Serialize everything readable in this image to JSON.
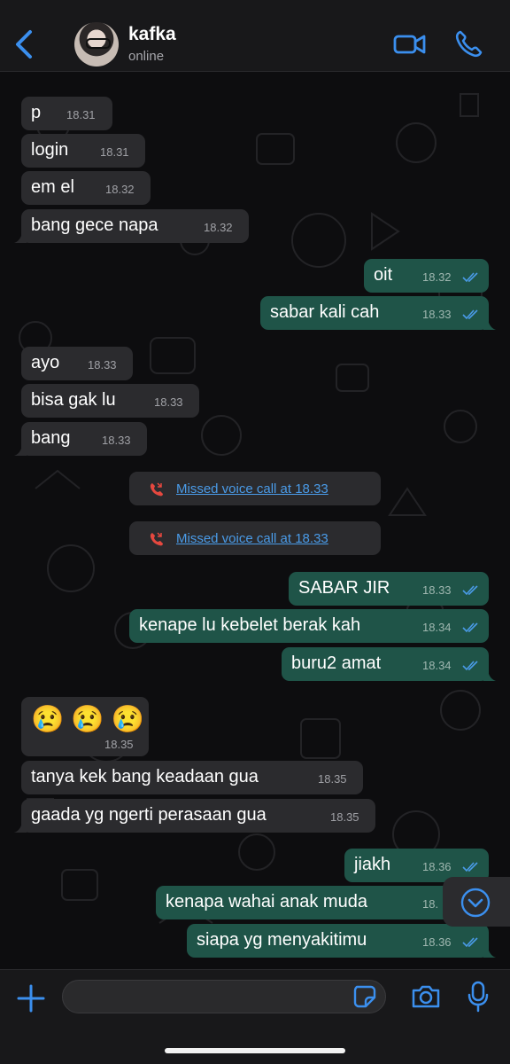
{
  "header": {
    "contact_name": "kafka",
    "contact_status": "online"
  },
  "messages": [
    {
      "text": "p",
      "time": "18.31"
    },
    {
      "text": "login",
      "time": "18.31"
    },
    {
      "text": "em el",
      "time": "18.32"
    },
    {
      "text": "bang gece napa",
      "time": "18.32"
    },
    {
      "text": "oit",
      "time": "18.32"
    },
    {
      "text": "sabar kali cah",
      "time": "18.33"
    },
    {
      "text": "ayo",
      "time": "18.33"
    },
    {
      "text": "bisa gak lu",
      "time": "18.33"
    },
    {
      "text": "bang",
      "time": "18.33"
    },
    {
      "text": "SABAR JIR",
      "time": "18.33"
    },
    {
      "text": "kenape lu kebelet berak kah",
      "time": "18.34"
    },
    {
      "text": "buru2 amat",
      "time": "18.34"
    },
    {
      "text": "😢😢😢",
      "time": "18.35"
    },
    {
      "text": "tanya kek bang keadaan gua",
      "time": "18.35"
    },
    {
      "text": "gaada yg ngerti perasaan gua",
      "time": "18.35"
    },
    {
      "text": "jiakh",
      "time": "18.36"
    },
    {
      "text": "kenapa wahai anak muda",
      "time": "18."
    },
    {
      "text": "siapa yg menyakitimu",
      "time": "18.36"
    }
  ],
  "calls": [
    {
      "text": "Missed voice call at 18.33"
    },
    {
      "text": "Missed voice call at 18.33"
    }
  ],
  "composer": {
    "value": ""
  },
  "colors": {
    "incoming_bubble": "#2b2b2e",
    "outgoing_bubble": "#1f5448",
    "read_ticks": "#4a9be8",
    "missed_call_icon": "#e5483f",
    "header_accent": "#3b8fee"
  },
  "icons": [
    "back-chevron-icon",
    "video-call-icon",
    "phone-icon",
    "missed-call-icon",
    "double-check-icon",
    "chevron-down-icon",
    "plus-icon",
    "sticker-icon",
    "camera-icon",
    "microphone-icon"
  ]
}
